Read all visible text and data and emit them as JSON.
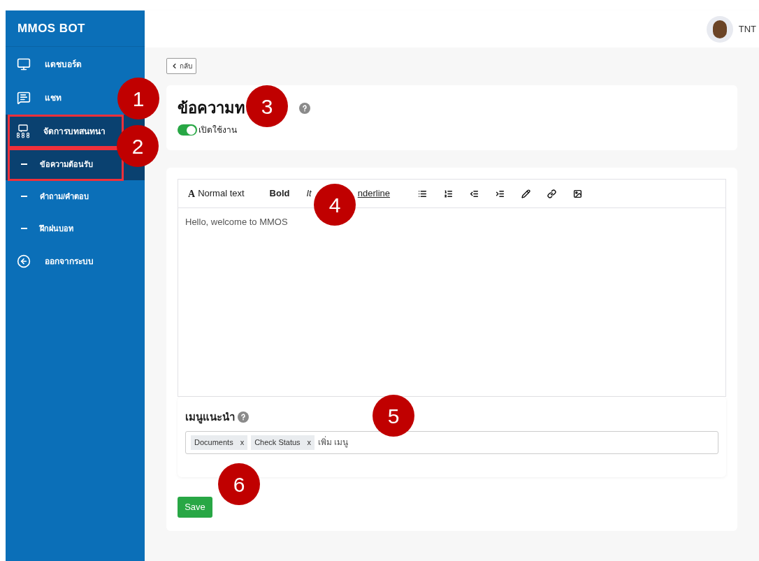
{
  "app": {
    "title": "MMOS BOT"
  },
  "sidebar": {
    "items": [
      {
        "label": "แดชบอร์ด",
        "selected": false
      },
      {
        "label": "แชท",
        "selected": false
      },
      {
        "label": "จัดการบทสนทนา",
        "selected": true,
        "children": [
          {
            "label": "ข้อความต้อนรับ",
            "selected": true
          },
          {
            "label": "คำถาม/คำตอบ",
            "selected": false
          },
          {
            "label": "ฝึกฝนบอท",
            "selected": false
          }
        ]
      },
      {
        "label": "ออกจากระบบ",
        "selected": false
      }
    ]
  },
  "user": {
    "name": "TNT"
  },
  "back_button": "กลับ",
  "header_card": {
    "title": "ข้อความท",
    "toggle": {
      "label": "เปิดใช้งาน",
      "on": true
    }
  },
  "editor": {
    "toolbar": [
      {
        "kind": "font",
        "glyph": "A",
        "label": "Normal text"
      },
      {
        "kind": "bold",
        "label": "Bold"
      },
      {
        "kind": "italic",
        "label": "It"
      },
      {
        "kind": "underline",
        "label": "nderline"
      },
      {
        "kind": "list"
      },
      {
        "kind": "bullets"
      },
      {
        "kind": "outdent"
      },
      {
        "kind": "indent"
      },
      {
        "kind": "pencil"
      },
      {
        "kind": "link"
      },
      {
        "kind": "image"
      }
    ],
    "content": "Hello, welcome to MMOS"
  },
  "suggested_menu": {
    "title": "เมนูแนะนำ",
    "tags": [
      {
        "label": "Documents",
        "remove": "x"
      },
      {
        "label": "Check Status",
        "remove": "x"
      }
    ],
    "placeholder": "เพิ่ม เมนู"
  },
  "save_button": "Save",
  "callouts": [
    {
      "label": "1"
    },
    {
      "label": "2"
    },
    {
      "label": "3"
    },
    {
      "label": "4"
    },
    {
      "label": "5"
    },
    {
      "label": "6"
    }
  ]
}
